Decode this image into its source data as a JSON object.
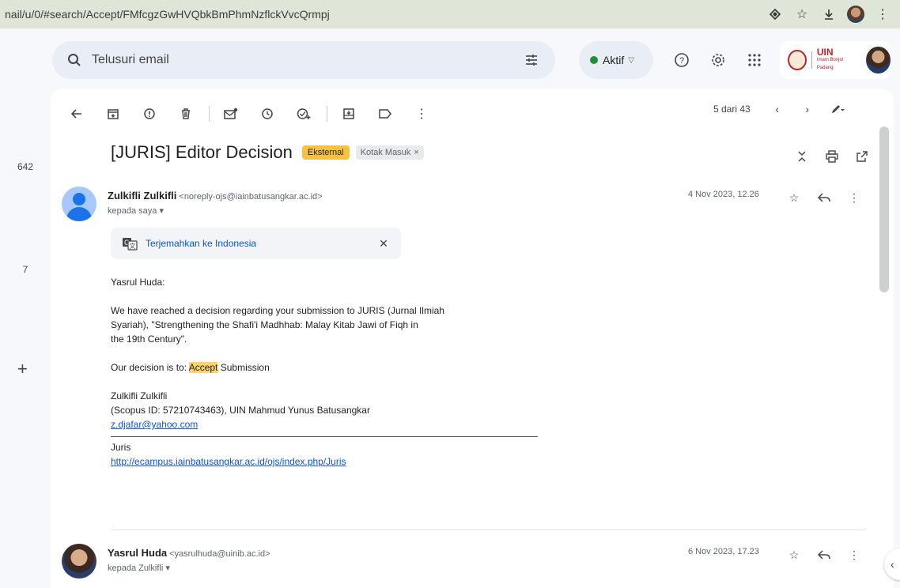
{
  "browser": {
    "url": "nail/u/0/#search/Accept/FMfcgzGwHVQbkBmPhmNzflckVvcQrmpj"
  },
  "rail": {
    "count1": "642",
    "count2": "7",
    "plus": "+"
  },
  "search": {
    "placeholder": "Telusuri email"
  },
  "status": {
    "label": "Aktif",
    "dot_color": "#1e8e3e"
  },
  "account": {
    "logo_text": "UIN",
    "logo_subtext": "Imam Bonjol Padang"
  },
  "toolbar": {
    "icons": [
      "back-arrow-icon",
      "archive-icon",
      "report-spam-icon",
      "delete-icon",
      "mark-unread-icon",
      "snooze-icon",
      "add-task-icon",
      "move-to-icon",
      "label-icon",
      "more-icon"
    ]
  },
  "pager": {
    "text": "5 dari 43"
  },
  "subject": {
    "title": "[JURIS] Editor Decision",
    "chip_external": "Eksternal",
    "chip_inbox": "Kotak Masuk",
    "chip_inbox_close": "×"
  },
  "messages": [
    {
      "sender_name": "Zulkifli Zulkifli",
      "sender_email": "<noreply-ojs@iainbatusangkar.ac.id>",
      "to": "kepada saya",
      "date": "4 Nov 2023, 12.26"
    },
    {
      "sender_name": "Yasrul Huda",
      "sender_email": "<yasrulhuda@uinib.ac.id>",
      "to": "kepada Zulkifli",
      "date": "6 Nov 2023, 17.23"
    }
  ],
  "translate": {
    "label": "Terjemahkan ke Indonesia",
    "close": "✕"
  },
  "body": {
    "greeting": "Yasrul Huda:",
    "para1_line1": "We have reached a decision regarding your submission to JURIS (Jurnal Ilmiah",
    "para1_line2": "Syariah), \"Strengthening the Shafi'i Madhhab: Malay Kitab Jawi of Fiqh in",
    "para1_line3": "the 19th Century\".",
    "decision_prefix": "Our decision is to:",
    "decision_highlight": "Accept",
    "decision_suffix": "Submission",
    "sig_name": "Zulkifli Zulkifli",
    "sig_affil": "(Scopus ID: 57210743463), UIN Mahmud Yunus Batusangkar",
    "sig_email": "z.djafar@yahoo.com",
    "journal": "Juris",
    "journal_url": "http://ecampus.iainbatusangkar.ac.id/ojs/index.php/Juris"
  },
  "side_tab": {
    "label": "‹"
  }
}
